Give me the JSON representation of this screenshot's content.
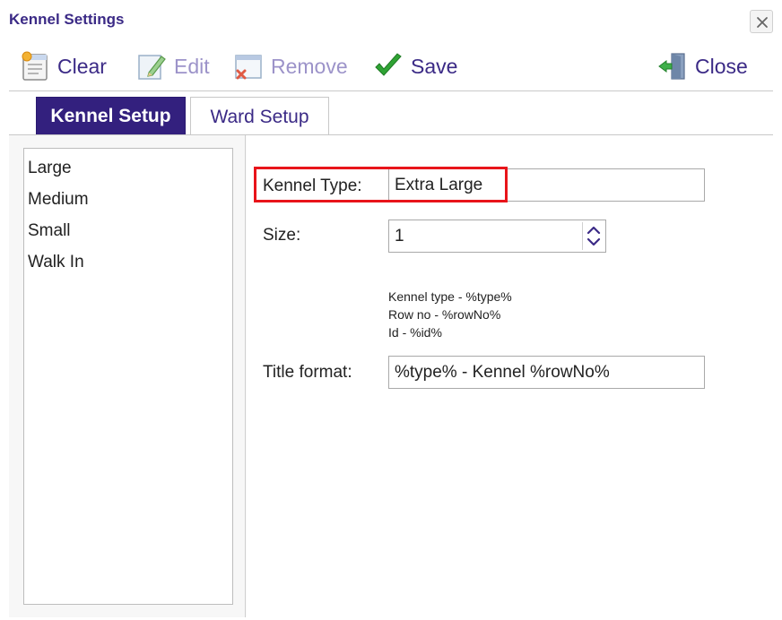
{
  "window": {
    "title": "Kennel Settings"
  },
  "toolbar": {
    "clear_label": "Clear",
    "edit_label": "Edit",
    "remove_label": "Remove",
    "save_label": "Save",
    "close_label": "Close"
  },
  "tabs": [
    {
      "label": "Kennel Setup"
    },
    {
      "label": "Ward Setup"
    }
  ],
  "kennel_list": [
    {
      "label": "Large"
    },
    {
      "label": "Medium"
    },
    {
      "label": "Small"
    },
    {
      "label": "Walk In"
    }
  ],
  "form": {
    "kennel_type_label": "Kennel Type:",
    "kennel_type_value": "Extra Large",
    "size_label": "Size:",
    "size_value": "1",
    "hint_lines": [
      "Kennel type - %type%",
      "Row no - %rowNo%",
      "Id - %id%"
    ],
    "title_format_label": "Title format:",
    "title_format_value": "%type% - Kennel %rowNo%"
  },
  "colors": {
    "accent": "#33207e",
    "highlight": "#e8141a",
    "save_check": "#2fa334"
  }
}
